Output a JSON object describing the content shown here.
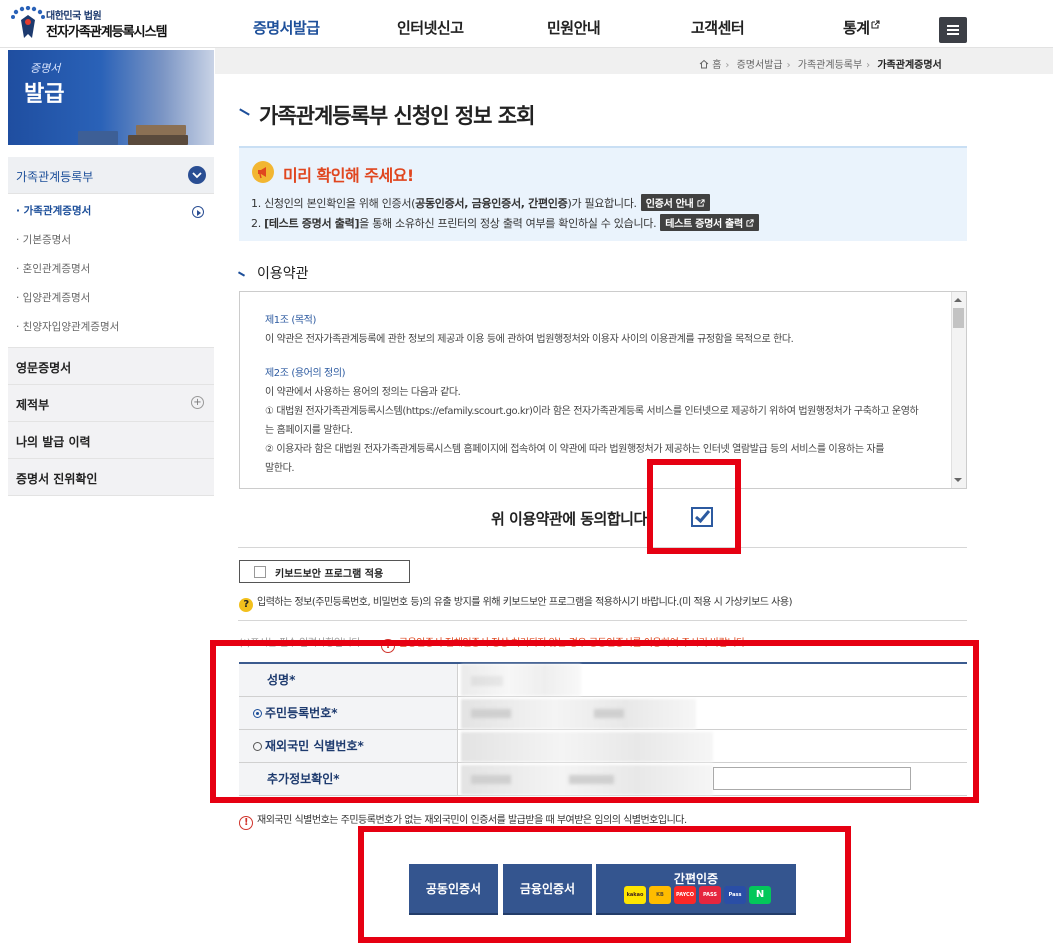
{
  "header": {
    "logo_sub": "대한민국 법원",
    "logo_main": "전자가족관계등록시스템",
    "nav": [
      {
        "label": "증명서발급",
        "active": true
      },
      {
        "label": "인터넷신고"
      },
      {
        "label": "민원안내"
      },
      {
        "label": "고객센터"
      },
      {
        "label": "통계"
      }
    ]
  },
  "sidebar": {
    "banner_line1": "증명서",
    "banner_line2": "발급",
    "categories": [
      {
        "label": "가족관계등록부"
      },
      {
        "label": "영문증명서"
      },
      {
        "label": "제적부"
      },
      {
        "label": "나의 발급 이력"
      },
      {
        "label": "증명서 진위확인"
      }
    ],
    "sub_items": [
      "· 가족관계증명서",
      "· 기본증명서",
      "· 혼인관계증명서",
      "· 입양관계증명서",
      "· 친양자입양관계증명서"
    ]
  },
  "breadcrumb": [
    "홈",
    "증명서발급",
    "가족관계등록부",
    "가족관계증명서"
  ],
  "page_title": "가족관계등록부 신청인 정보 조회",
  "notice": {
    "title": "미리 확인해 주세요!",
    "line1_a": "1. 신청인의 본인확인을 위해 인증서(",
    "line1_b": "공동인증서, 금융인증서, 간편인증",
    "line1_c": ")가 필요합니다.",
    "line1_btn": "인증서 안내",
    "line2_a": "2. ",
    "line2_b": "[테스트 증명서 출력]",
    "line2_c": "을 통해 소유하신 프린터의 정상 출력 여부를 확인하실 수 있습니다.",
    "line2_btn": "테스트 증명서 출력"
  },
  "terms": {
    "section_title": "이용약관",
    "art1_title": "제1조 (목적)",
    "art1_text": "이 약관은 전자가족관계등록에 관한 정보의 제공과 이용 등에 관하여 법원행정처와 이용자 사이의 이용관계를 규정함을 목적으로 한다.",
    "art2_title": "제2조 (용어의 정의)",
    "art2_text": "이 약관에서 사용하는 용어의 정의는 다음과 같다.",
    "art2_item1a": "① 대법원 전자가족관계등록시스템(https://efamily.scourt.go.kr)이라 함은 전자가족관계등록 서비스를 인터넷으로 제공하기 위하여 법원행정처가 구축하고 운영하",
    "art2_item1b": "는 홈페이지를 말한다.",
    "art2_item2a": "② 이용자라 함은 대법원 전자가족관계등록시스템 홈페이지에 접속하여 이 약관에 따라 법원행정처가 제공하는 인터넷 열람발급 등의 서비스를 이용하는 자를",
    "art2_item2b": "말한다."
  },
  "agree_text": "위 이용약관에 동의합니다.",
  "agree_checked": true,
  "keyboard_btn": "키보드보안 프로그램 적용",
  "keyboard_help": "입력하는 정보(주민등록번호, 비밀번호 등)의 유출 방지를 위해 키보드보안 프로그램을 적용하시기 바랍니다.(미 적용 시 가상키보드 사용)",
  "required_note": "(*)표시는 필수 입력사항입니다.",
  "required_warn": "금융인증서 전체인증서 정상 처리되지 않는 경우 공동인증서를 이용하여 주시기 바랍니다.",
  "form": {
    "name_label": "성명",
    "rrn_label": "주민등록번호",
    "foreign_label": "재외국민 식별번호",
    "extra_label": "추가정보확인",
    "star": "*"
  },
  "foreign_note": "재외국민 식별번호는 주민등록번호가 없는 재외국민이 인증서를 발급받을 때 부여받은 임의의 식별번호입니다.",
  "auth": {
    "joint": "공동인증서",
    "finance": "금융인증서",
    "simple": "간편인증",
    "providers": [
      "kakao",
      "KB",
      "PAYCO",
      "PASS",
      "Pass",
      "N"
    ]
  },
  "colors": {
    "brand": "#1d4f9a",
    "button": "#34558f",
    "annotation": "#e60012"
  }
}
